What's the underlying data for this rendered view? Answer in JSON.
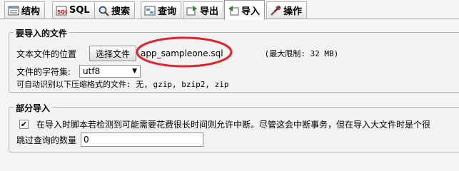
{
  "tabs": [
    {
      "label": "结构",
      "icon": "structure-icon"
    },
    {
      "label": "SQL",
      "icon": "sql-icon"
    },
    {
      "label": "搜索",
      "icon": "search-icon"
    },
    {
      "label": "查询",
      "icon": "query-icon"
    },
    {
      "label": "导出",
      "icon": "export-icon"
    },
    {
      "label": "导入",
      "icon": "import-icon",
      "active": true
    },
    {
      "label": "操作",
      "icon": "operations-icon"
    }
  ],
  "file_section": {
    "legend": "要导入的文件",
    "location_label": "文本文件的位置",
    "choose_file_button": "选择文件",
    "chosen_file": "app_sampleone.sql",
    "max_limit": "(最大限制: 32 MB)",
    "charset_label": "文件的字符集:",
    "charset_value": "utf8",
    "compression_note": "可自动识别以下压缩格式的文件: 无, gzip, bzip2, zip"
  },
  "partial_section": {
    "legend": "部分导入",
    "interrupt_text": "在导入时脚本若检测到可能需要花费很长时间则允许中断。尽管这会中断事务，但在导入大文件时是个很",
    "interrupt_checked": true,
    "skip_label": "跳过查询的数量",
    "skip_value": "0"
  },
  "colors": {
    "highlight_circle": "#e0242b"
  }
}
